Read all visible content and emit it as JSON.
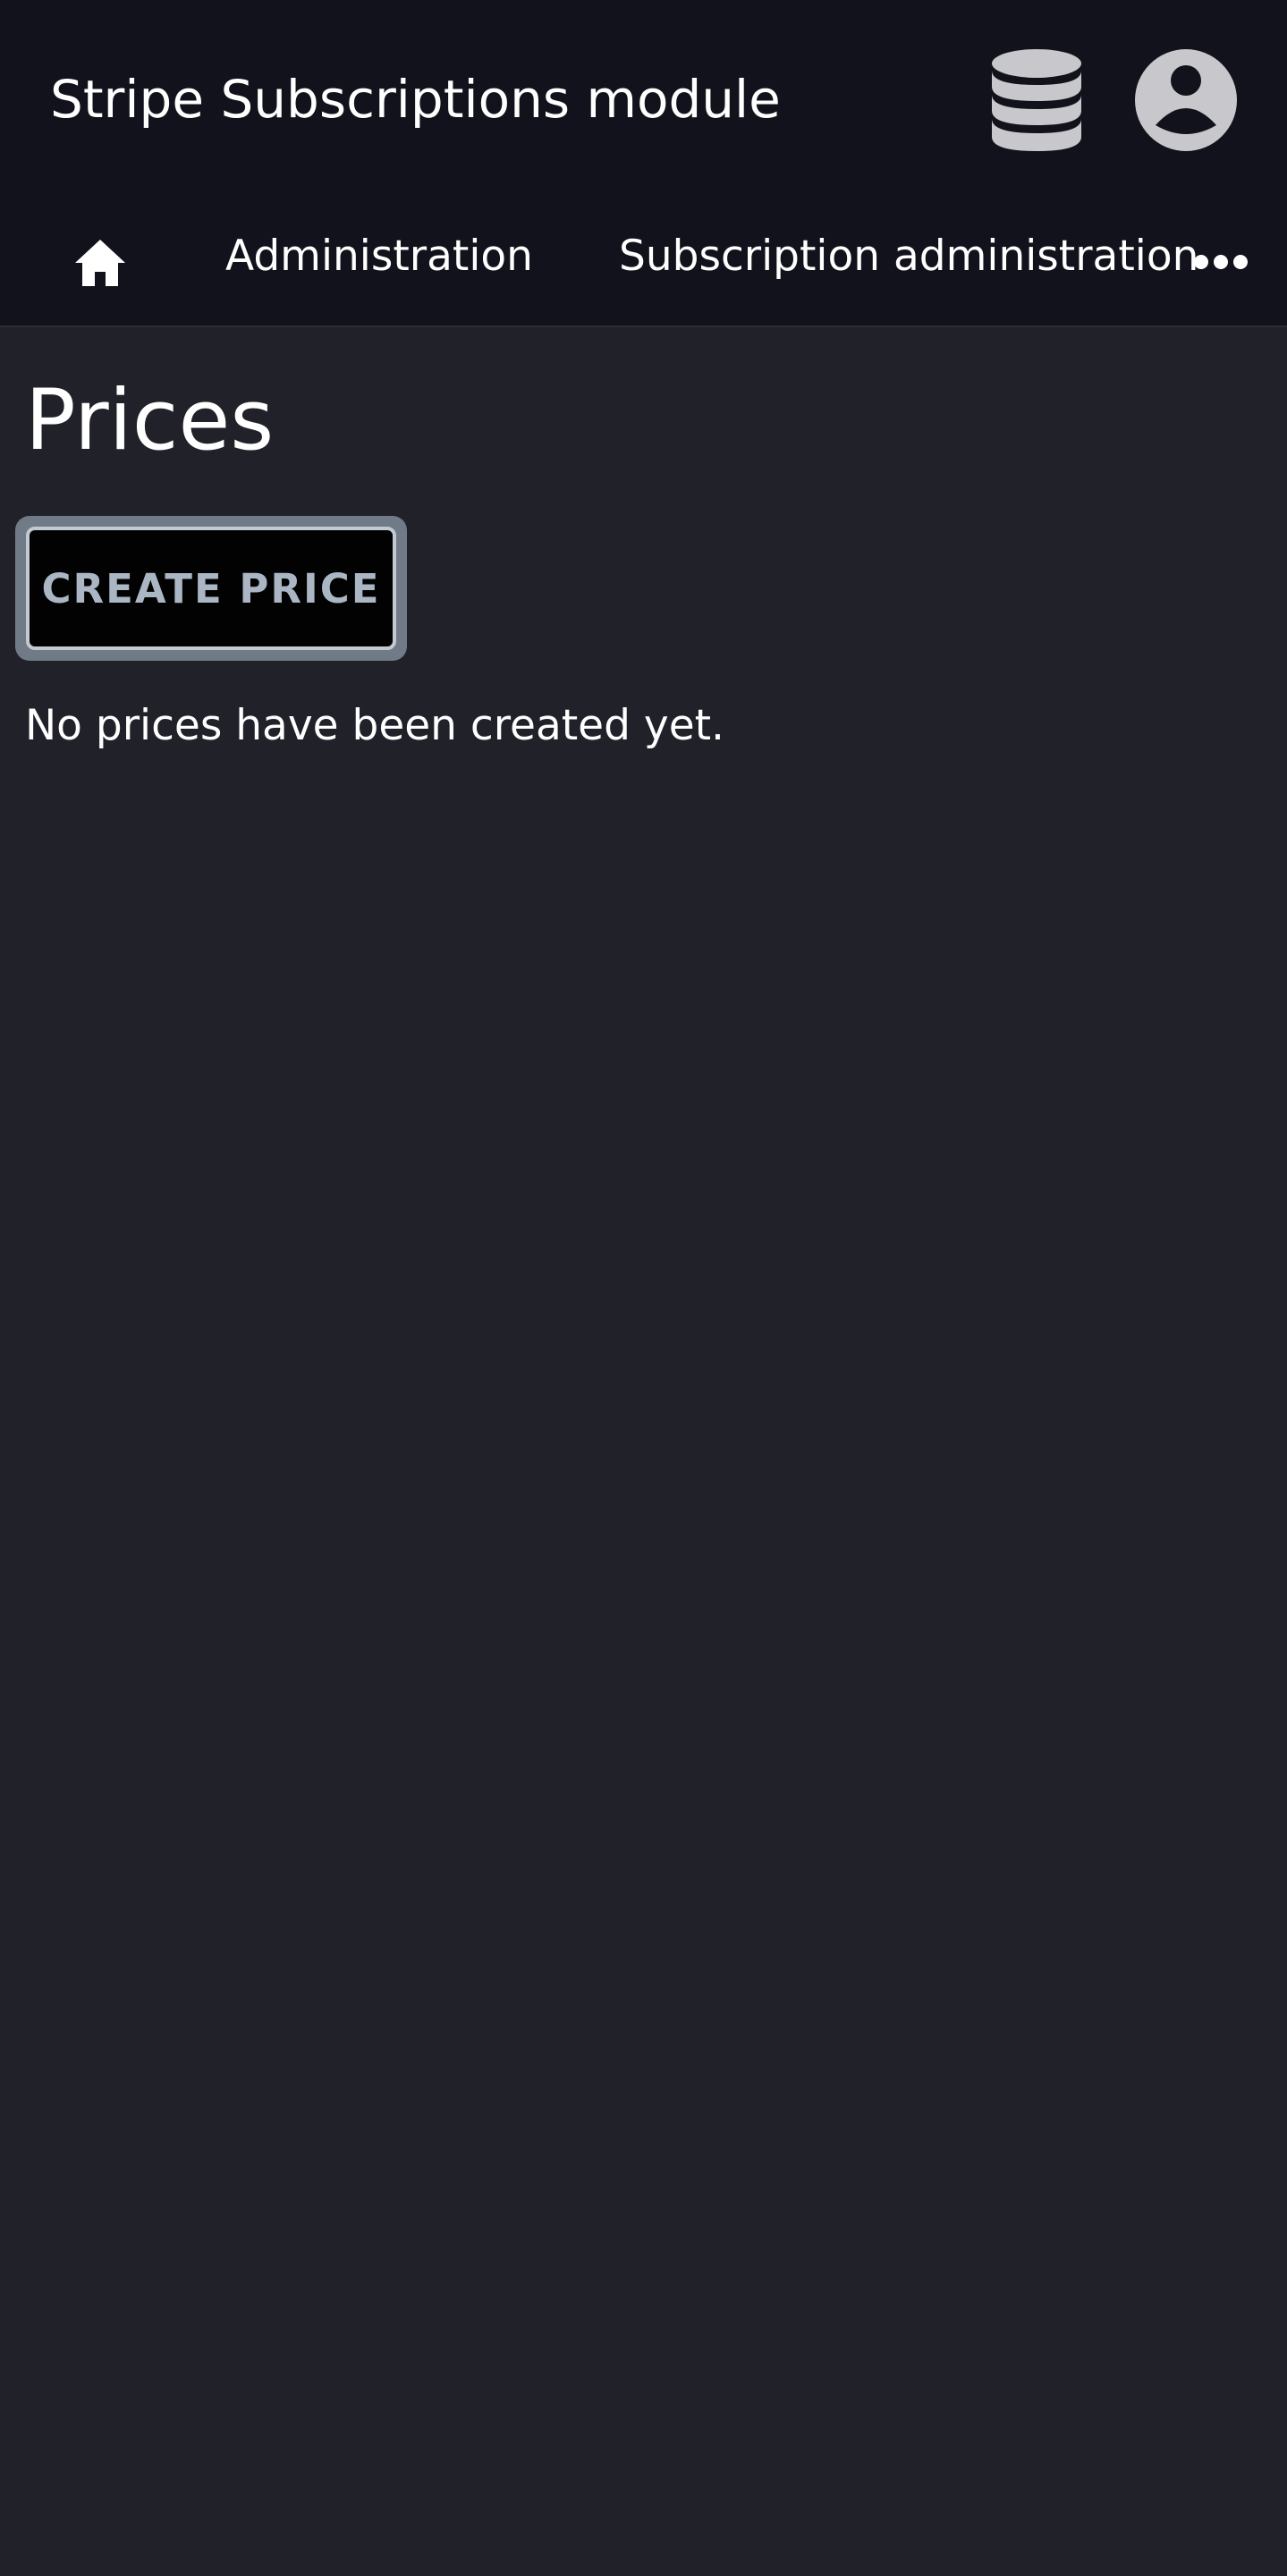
{
  "header": {
    "app_title": "Stripe Subscriptions module",
    "icons": {
      "database": "database-icon",
      "account": "user-account-icon"
    }
  },
  "breadcrumb": {
    "home_icon": "home-icon",
    "items": [
      {
        "label": "Administration"
      },
      {
        "label": "Subscription administration"
      }
    ],
    "more_icon": "more-horizontal-icon"
  },
  "main": {
    "title": "Prices",
    "create_button_label": "CREATE PRICE",
    "empty_message": "No prices have been created yet."
  },
  "colors": {
    "topbar_bg": "#12121c",
    "page_bg": "#21212a",
    "button_outline": "#717b88",
    "button_text": "#aab6c3",
    "icon_gray": "#c8c8cc"
  }
}
